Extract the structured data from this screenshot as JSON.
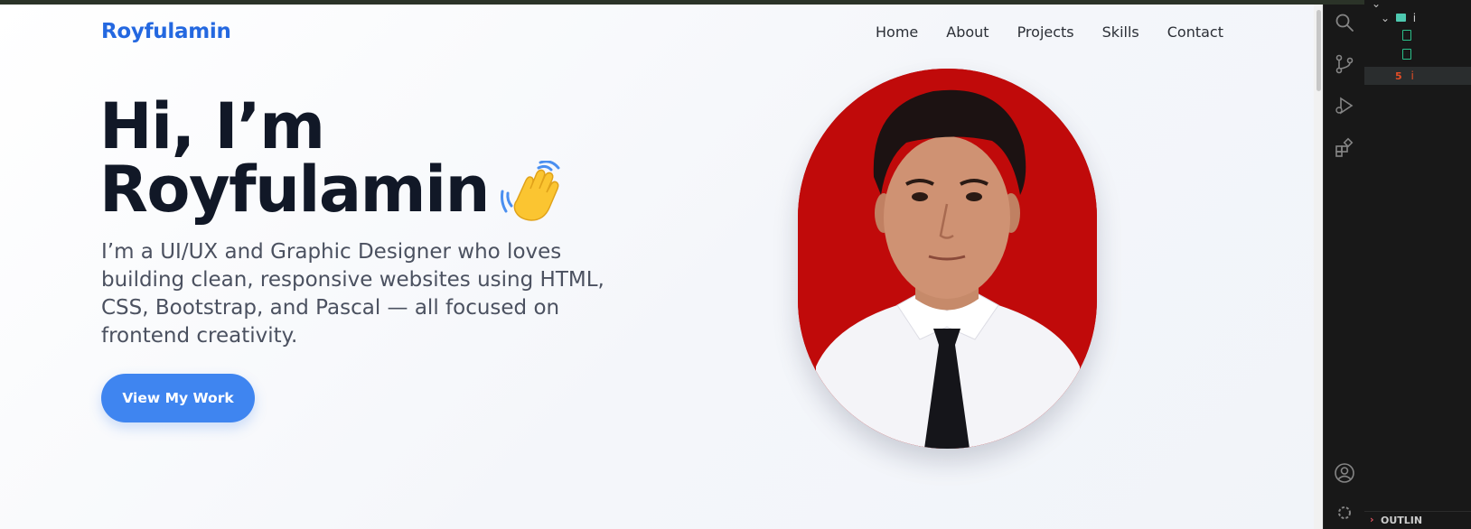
{
  "site": {
    "brand": "Royfulamin",
    "nav": [
      "Home",
      "About",
      "Projects",
      "Skills",
      "Contact"
    ],
    "hero": {
      "title_line1": "Hi, I’m",
      "title_line2": "Royfulamin",
      "description": "I’m a UI/UX and Graphic Designer who loves building clean, responsive websites using HTML, CSS, Bootstrap, and Pascal — all focused on frontend creativity.",
      "cta_label": "View My Work",
      "emoji": "waving-hand"
    },
    "photo": "profile-photo"
  },
  "colors": {
    "brand": "#2468e0",
    "button": "#3f85f0",
    "heading": "#111827",
    "photo_background": "#c00a0a"
  },
  "editor": {
    "activity_icons": [
      "search-icon",
      "source-control-icon",
      "run-debug-icon",
      "extensions-icon",
      "account-icon"
    ],
    "explorer_rows": [
      "",
      "i",
      "",
      "",
      "i"
    ],
    "outline_label": "OUTLIN"
  }
}
